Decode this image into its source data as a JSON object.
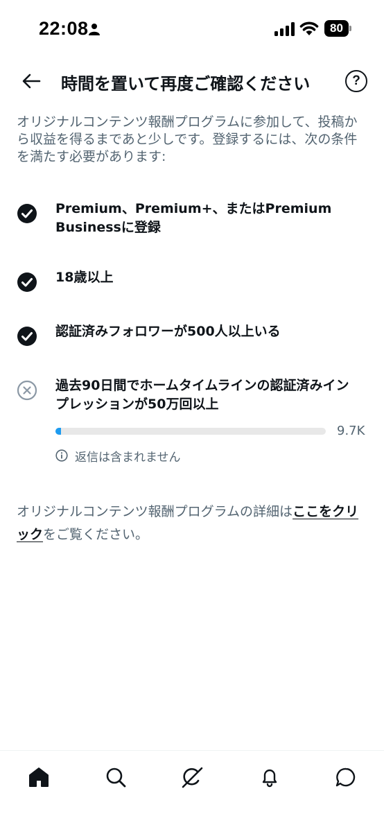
{
  "status_bar": {
    "time": "22:08",
    "battery": "80"
  },
  "header": {
    "title": "時間を置いて再度ご確認ください",
    "back_icon": "arrow-left-icon",
    "help_label": "?"
  },
  "intro": "オリジナルコンテンツ報酬プログラムに参加して、投稿から収益を得るまであと少しです。登録するには、次の条件を満たす必要があります:",
  "requirements": [
    {
      "text": "Premium、Premium+、またはPremium Businessに登録",
      "met": true
    },
    {
      "text": "18歳以上",
      "met": true
    },
    {
      "text": "認証済みフォロワーが500人以上いる",
      "met": true
    },
    {
      "text": "過去90日間でホームタイムラインの認証済みインプレッションが50万回以上",
      "met": false
    }
  ],
  "progress": {
    "value_label": "9.7K",
    "fraction": 0.0194,
    "note": "返信は含まれません"
  },
  "details": {
    "before": "オリジナルコンテンツ報酬プログラムの詳細は",
    "link": "ここをクリック",
    "after": "をご覧ください。"
  },
  "bottom_nav": [
    "home-icon",
    "search-icon",
    "grok-icon",
    "notifications-icon",
    "messages-icon"
  ],
  "colors": {
    "text": "#0f1419",
    "secondary": "#536471",
    "accent": "#1d9bf0",
    "track": "#e8e8e8"
  }
}
